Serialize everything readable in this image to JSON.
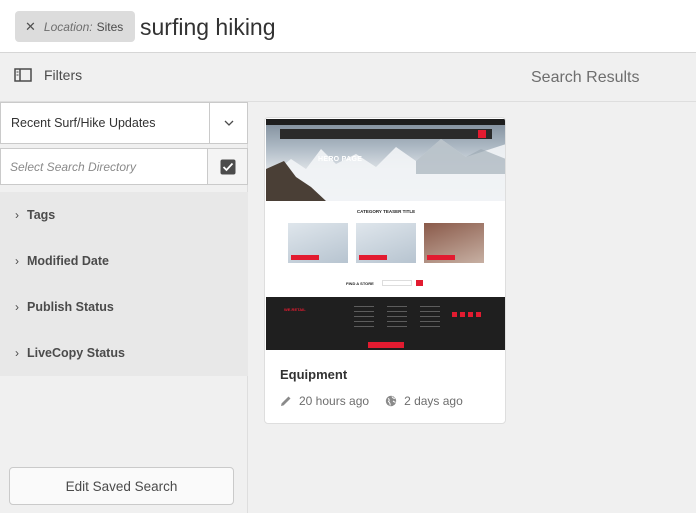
{
  "search": {
    "tag_key": "Location:",
    "tag_value": "Sites",
    "query": "surfing hiking"
  },
  "header": {
    "filters_label": "Filters",
    "results_title": "Search Results"
  },
  "rail": {
    "saved_search": "Recent Surf/Hike Updates",
    "directory_placeholder": "Select Search Directory",
    "filters": [
      {
        "label": "Tags"
      },
      {
        "label": "Modified Date"
      },
      {
        "label": "Publish Status"
      },
      {
        "label": "LiveCopy Status"
      }
    ],
    "edit_button": "Edit Saved Search"
  },
  "result": {
    "title": "Equipment",
    "modified": "20 hours ago",
    "published": "2 days ago",
    "thumbnail": {
      "hero_title": "HERO PAGE",
      "teaser_title": "CATEGORY TEASER TITLE",
      "store_label": "FIND A STORE",
      "brand": "WE.RETAIL"
    }
  },
  "colors": {
    "accent_red": "#e21b30",
    "rail_bg": "#f0f0f0"
  }
}
